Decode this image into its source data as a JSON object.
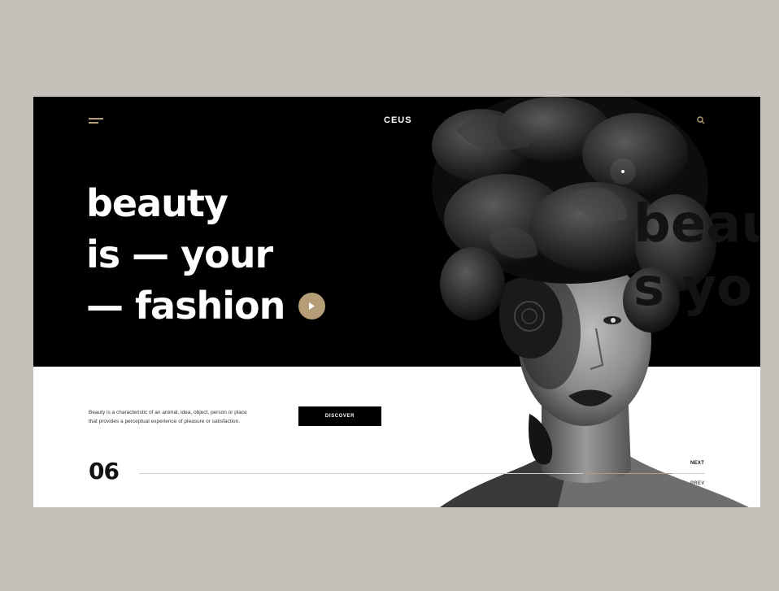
{
  "header": {
    "logo": "CEUS",
    "menu_icon": "hamburger-menu-icon",
    "search_icon": "search-icon"
  },
  "hero": {
    "line1": "beauty",
    "line2": "is — your",
    "line3": "— fashion",
    "play_icon": "play-icon",
    "ghost_line1": "beau",
    "ghost_line2": "s yo"
  },
  "content": {
    "description_line1": "Beauty is a characteristic of an animal, idea, object, person or place",
    "description_line2": "that provides a perceptual experience of pleasure or satisfaction.",
    "discover_label": "DISCOVER"
  },
  "slider": {
    "number": "06",
    "next_label": "NEXT",
    "prev_label": "PREV"
  },
  "colors": {
    "background": "#c6c0bb",
    "accent": "#b59d77",
    "dark": "#000000",
    "light": "#ffffff"
  }
}
